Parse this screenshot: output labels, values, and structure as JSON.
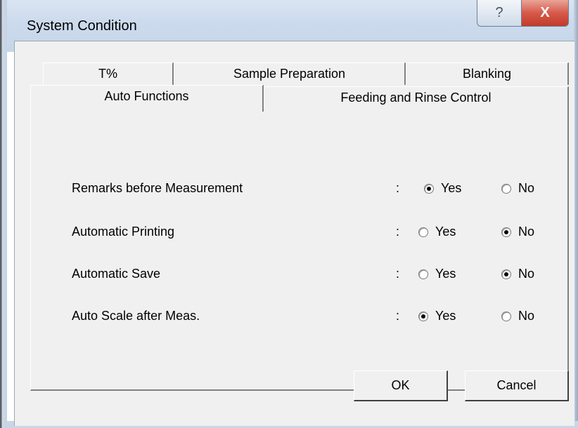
{
  "window": {
    "title": "System Condition"
  },
  "caption_buttons": {
    "help": "?",
    "close": "X"
  },
  "tabs": {
    "back_row": [
      "T%",
      "Sample Preparation",
      "Blanking"
    ],
    "front_row": [
      "Auto Functions",
      "Feeding and Rinse Control"
    ],
    "active": "Auto Functions"
  },
  "settings": {
    "separator": ":",
    "yes_label": "Yes",
    "no_label": "No",
    "rows": [
      {
        "label": "Remarks before Measurement",
        "value": "Yes"
      },
      {
        "label": "Automatic Printing",
        "value": "No"
      },
      {
        "label": "Automatic Save",
        "value": "No"
      },
      {
        "label": "Auto Scale after Meas.",
        "value": "Yes"
      }
    ]
  },
  "buttons": {
    "ok": "OK",
    "cancel": "Cancel"
  }
}
